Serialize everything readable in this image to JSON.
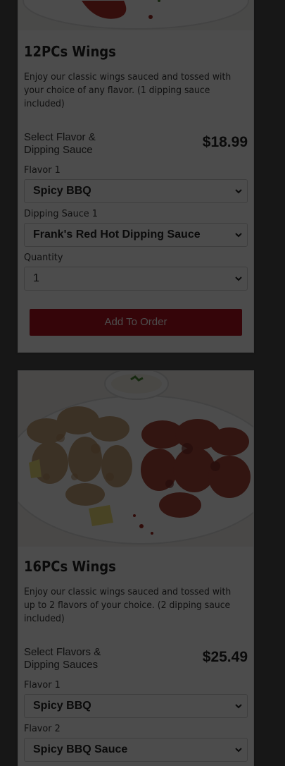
{
  "menu_items": [
    {
      "title": "12PCs Wings",
      "description": "Enjoy our classic wings sauced and tossed with your choice of any flavor. (1 dipping sauce included)",
      "select_label": "Select Flavor & Dipping Sauce",
      "price": "$18.99",
      "fields": [
        {
          "label": "Flavor 1",
          "value": "Spicy BBQ"
        },
        {
          "label": "Dipping Sauce 1",
          "value": "Frank's Red Hot Dipping Sauce"
        },
        {
          "label": "Quantity",
          "value": "1"
        }
      ],
      "button_label": "Add To Order"
    },
    {
      "title": "16PCs Wings",
      "description": "Enjoy our classic wings sauced and tossed with up to 2 flavors of your choice. (2 dipping sauce included)",
      "select_label": "Select Flavors & Dipping Sauces",
      "price": "$25.49",
      "fields": [
        {
          "label": "Flavor 1",
          "value": "Spicy BBQ"
        },
        {
          "label": "Flavor 2",
          "value": "Spicy BBQ Sauce"
        }
      ]
    }
  ],
  "colors": {
    "accent": "#b3121e",
    "overlay": "rgba(0,0,0,0.7)"
  }
}
